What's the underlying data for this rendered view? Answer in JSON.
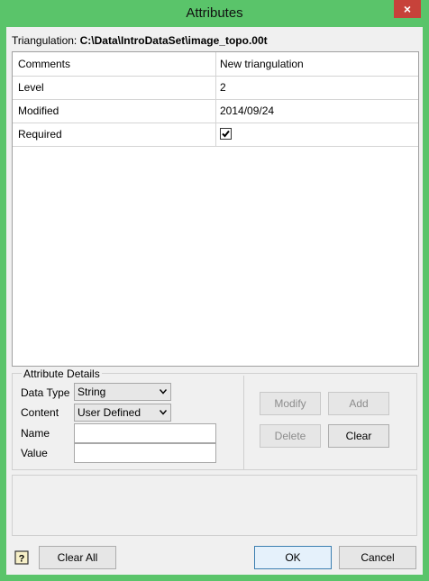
{
  "window": {
    "title": "Attributes",
    "close_glyph": "×"
  },
  "triangulation": {
    "label": "Triangulation:",
    "path": "C:\\Data\\IntroDataSet\\image_topo.00t"
  },
  "attributes": [
    {
      "name": "Comments",
      "value": "New triangulation"
    },
    {
      "name": "Level",
      "value": "2"
    },
    {
      "name": "Modified",
      "value": "2014/09/24"
    },
    {
      "name": "Required",
      "value": true
    }
  ],
  "details": {
    "legend": "Attribute Details",
    "data_type_label": "Data Type",
    "data_type_value": "String",
    "content_label": "Content",
    "content_value": "User Defined",
    "name_label": "Name",
    "name_value": "",
    "value_label": "Value",
    "value_value": ""
  },
  "buttons": {
    "modify": "Modify",
    "add": "Add",
    "delete": "Delete",
    "clear": "Clear",
    "clear_all": "Clear All",
    "ok": "OK",
    "cancel": "Cancel"
  },
  "icons": {
    "help": "help-icon",
    "checkbox": "check-icon",
    "dropdown": "chevron-down-icon"
  },
  "colors": {
    "titlebar": "#5ac46a",
    "close": "#c7423a",
    "default_button_border": "#3c7fb1"
  }
}
